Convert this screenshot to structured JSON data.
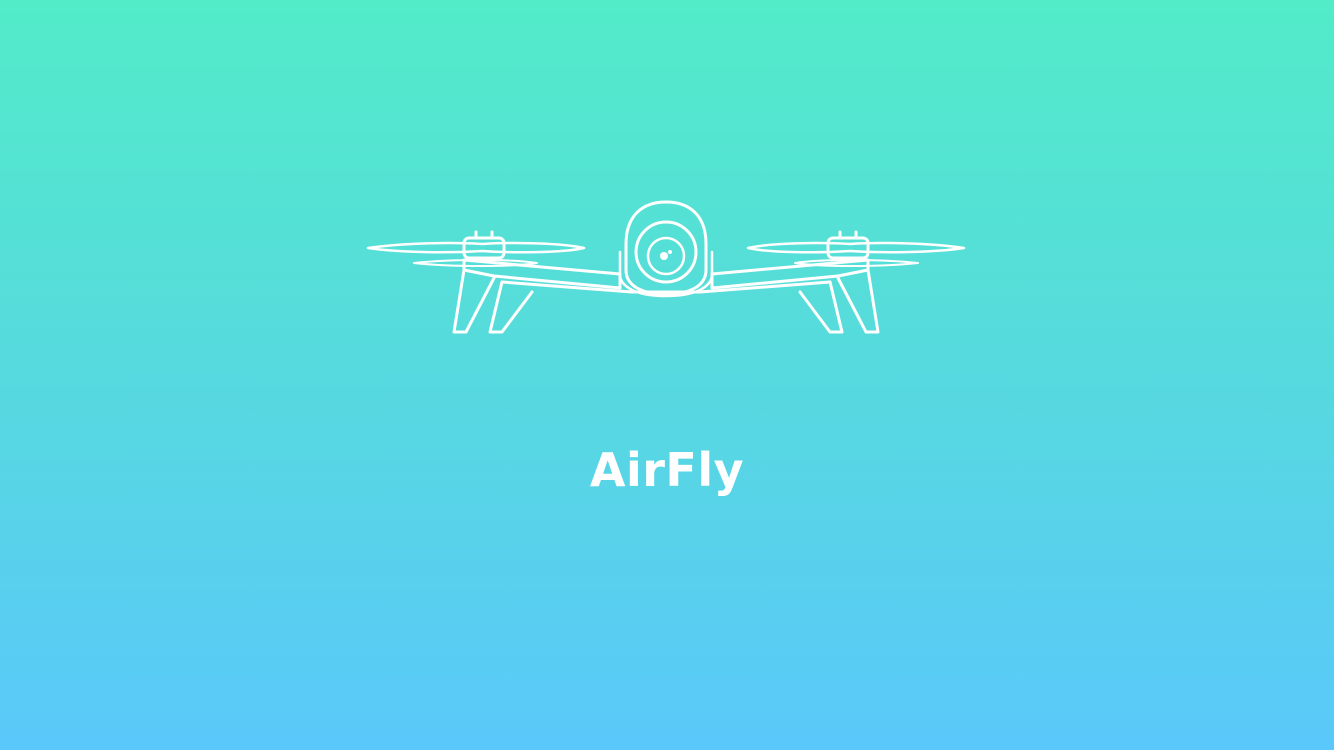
{
  "splash": {
    "app_name": "AirFly",
    "logo_icon": "drone-icon",
    "colors": {
      "gradient_top": "#52ECC9",
      "gradient_bottom": "#5AC8FA",
      "foreground": "#FFFFFF"
    }
  }
}
